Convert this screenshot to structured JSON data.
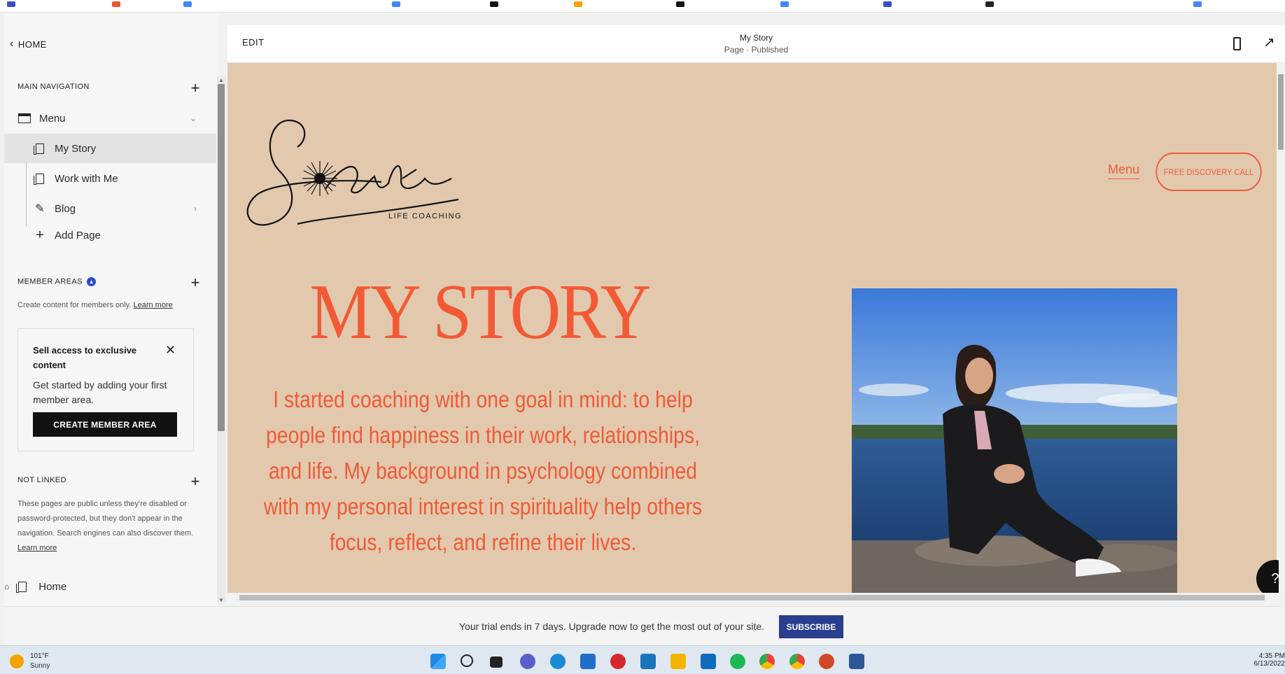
{
  "sidebar": {
    "home_label": "HOME",
    "main_nav_title": "MAIN NAVIGATION",
    "menu_folder": "Menu",
    "pages": [
      {
        "label": "My Story"
      },
      {
        "label": "Work with Me"
      },
      {
        "label": "Blog"
      }
    ],
    "add_page_label": "Add Page",
    "member_areas_title": "MEMBER AREAS",
    "member_desc": "Create content for members only.",
    "member_learn_more": "Learn more",
    "promo": {
      "title": "Sell access to exclusive content",
      "body": "Get started by adding your first member area.",
      "button": "CREATE MEMBER AREA"
    },
    "not_linked_title": "NOT LINKED",
    "not_linked_desc": "These pages are public unless they're disabled or password-protected, but they don't appear in the navigation. Search engines can also discover them.",
    "not_linked_learn_more": "Learn more",
    "home_page_label": "Home"
  },
  "topbar": {
    "edit_label": "EDIT",
    "page_title": "My Story",
    "page_status": "Page · Published"
  },
  "site": {
    "logo_word": "Stasta",
    "logo_tagline": "LIFE COACHING",
    "menu_link": "Menu",
    "cta": "FREE DISCOVERY CALL",
    "headline": "MY STORY",
    "story_text": "I started coaching with one goal in mind: to help people find happiness in their work, relationships, and life. My background in psychology combined with my personal interest in spirituality help others focus, reflect, and refine their lives.",
    "help_label": "?"
  },
  "trial_bar": {
    "text": "Your trial ends in 7 days. Upgrade now to get the most out of your site.",
    "button": "SUBSCRIBE"
  },
  "taskbar": {
    "temperature": "101°F",
    "condition": "Sunny",
    "time": "4:35 PM",
    "date": "6/13/2022",
    "apps": [
      "windows-start",
      "search",
      "task-view",
      "teams-chat",
      "edge",
      "mail",
      "vivaldi",
      "app-s",
      "file-explorer",
      "outlook",
      "spotify",
      "chrome",
      "chrome-profile",
      "powerpoint",
      "word"
    ]
  },
  "colors": {
    "site_background": "#e2c9ad",
    "accent": "#f25a36",
    "subscribe": "#2a3e8e"
  }
}
